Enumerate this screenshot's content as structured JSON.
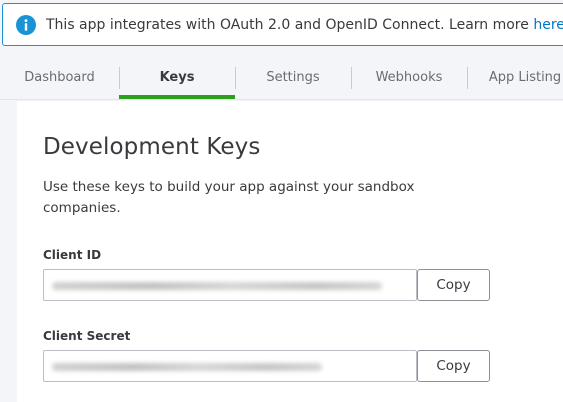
{
  "banner": {
    "text": "This app integrates with OAuth 2.0 and OpenID Connect. Learn more ",
    "link_label": "here",
    "suffix": " .",
    "icon": "info-icon",
    "accent_color": "#1a93d6"
  },
  "tabs": [
    {
      "label": "Dashboard",
      "active": false
    },
    {
      "label": "Keys",
      "active": true
    },
    {
      "label": "Settings",
      "active": false
    },
    {
      "label": "Webhooks",
      "active": false
    },
    {
      "label": "App Listing",
      "active": false
    }
  ],
  "colors": {
    "active_tab_underline": "#2ca01c",
    "link": "#0077c5"
  },
  "main": {
    "title": "Development Keys",
    "description": "Use these keys to build your app against your sandbox companies.",
    "client_id": {
      "label": "Client ID",
      "value": "",
      "copy_label": "Copy"
    },
    "client_secret": {
      "label": "Client Secret",
      "value": "",
      "copy_label": "Copy"
    }
  }
}
